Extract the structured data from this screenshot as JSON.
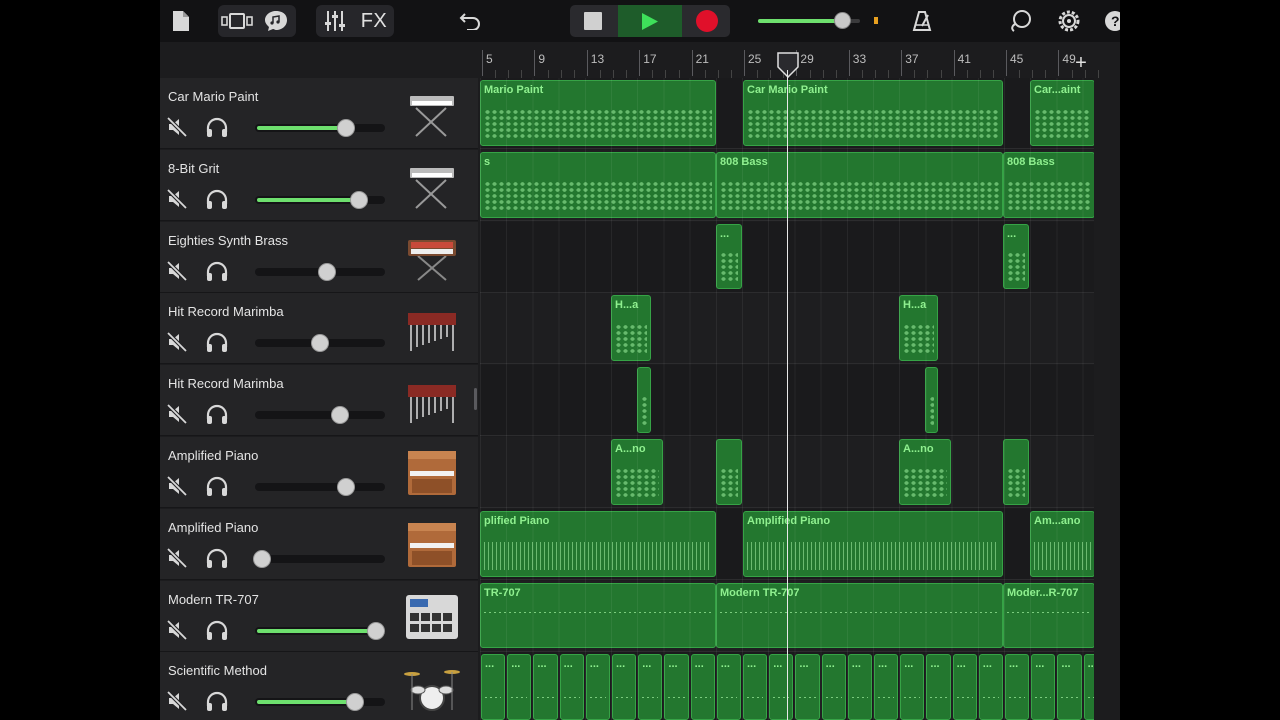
{
  "toolbar": {
    "fx_label": "FX",
    "accent": "#36a346",
    "record_color": "#e0102a",
    "master_volume": 0.82
  },
  "ruler": {
    "bars": [
      "5",
      "9",
      "13",
      "17",
      "21",
      "25",
      "29",
      "33",
      "37",
      "41",
      "45",
      "49"
    ],
    "add_label": "+"
  },
  "tracks": [
    {
      "name": "Car Mario Paint",
      "volume": 0.7,
      "active": true,
      "icon": "synth-keyboard-icon"
    },
    {
      "name": "8-Bit Grit",
      "volume": 0.8,
      "active": true,
      "icon": "synth-keyboard-icon"
    },
    {
      "name": "Eighties Synth Brass",
      "volume": 0.55,
      "active": false,
      "icon": "analog-synth-icon"
    },
    {
      "name": "Hit Record Marimba",
      "volume": 0.5,
      "active": false,
      "icon": "marimba-icon"
    },
    {
      "name": "Hit Record Marimba",
      "volume": 0.65,
      "active": false,
      "icon": "marimba-icon"
    },
    {
      "name": "Amplified Piano",
      "volume": 0.7,
      "active": false,
      "icon": "upright-piano-icon"
    },
    {
      "name": "Amplified Piano",
      "volume": 0.05,
      "active": true,
      "icon": "upright-piano-icon"
    },
    {
      "name": "Modern TR-707",
      "volume": 0.93,
      "active": true,
      "icon": "drum-machine-icon"
    },
    {
      "name": "Scientific Method",
      "volume": 0.77,
      "active": true,
      "icon": "drum-kit-icon"
    }
  ],
  "regions": [
    {
      "track": 0,
      "start": 0,
      "end": 236,
      "label": "Mario Paint",
      "style": "notes"
    },
    {
      "track": 0,
      "start": 263,
      "end": 523,
      "label": "Car Mario Paint",
      "style": "notes"
    },
    {
      "track": 0,
      "start": 550,
      "end": 615,
      "label": "Car...aint",
      "style": "notes"
    },
    {
      "track": 1,
      "start": 0,
      "end": 236,
      "label": "s",
      "style": "notes"
    },
    {
      "track": 1,
      "start": 236,
      "end": 523,
      "label": "808 Bass",
      "style": "notes"
    },
    {
      "track": 1,
      "start": 523,
      "end": 615,
      "label": "808 Bass",
      "style": "notes"
    },
    {
      "track": 2,
      "start": 236,
      "end": 262,
      "label": "...",
      "style": "notes"
    },
    {
      "track": 2,
      "start": 523,
      "end": 549,
      "label": "...",
      "style": "notes"
    },
    {
      "track": 3,
      "start": 131,
      "end": 171,
      "label": "H...a",
      "style": "notes"
    },
    {
      "track": 3,
      "start": 419,
      "end": 458,
      "label": "H...a",
      "style": "notes"
    },
    {
      "track": 4,
      "start": 157,
      "end": 171,
      "label": "",
      "style": "notes"
    },
    {
      "track": 4,
      "start": 445,
      "end": 458,
      "label": "",
      "style": "notes"
    },
    {
      "track": 5,
      "start": 131,
      "end": 183,
      "label": "A...no",
      "style": "notes"
    },
    {
      "track": 5,
      "start": 236,
      "end": 262,
      "label": "",
      "style": "notes"
    },
    {
      "track": 5,
      "start": 419,
      "end": 471,
      "label": "A...no",
      "style": "notes"
    },
    {
      "track": 5,
      "start": 523,
      "end": 549,
      "label": "",
      "style": "notes"
    },
    {
      "track": 6,
      "start": 0,
      "end": 236,
      "label": "plified Piano",
      "style": "bars"
    },
    {
      "track": 6,
      "start": 263,
      "end": 523,
      "label": "Amplified Piano",
      "style": "bars"
    },
    {
      "track": 6,
      "start": 550,
      "end": 615,
      "label": "Am...ano",
      "style": "bars"
    },
    {
      "track": 7,
      "start": 0,
      "end": 236,
      "label": "TR-707",
      "style": "dash"
    },
    {
      "track": 7,
      "start": 236,
      "end": 523,
      "label": "Modern TR-707",
      "style": "dash"
    },
    {
      "track": 7,
      "start": 523,
      "end": 615,
      "label": "Moder...R-707",
      "style": "dash"
    }
  ],
  "drum_pattern": {
    "track": 8,
    "label": "..."
  }
}
